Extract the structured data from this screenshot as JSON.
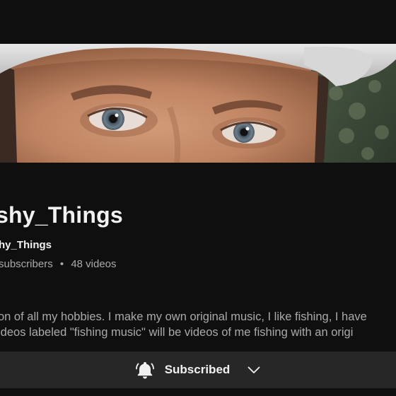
{
  "channel": {
    "name": "shy_Things",
    "handle": "hy_Things",
    "subscribers": "subscribers",
    "videos": "48 videos",
    "separator": "•"
  },
  "description": {
    "line1": "on of all my hobbies. I make my own original music, I like fishing, I have",
    "line2": "ideos labeled \"fishing music\" will be videos of me fishing with an origi"
  },
  "subscribe": {
    "label": "Subscribed"
  },
  "icons": {
    "bell": "bell-icon",
    "chevron": "chevron-down-icon"
  },
  "colors": {
    "background": "#0f0f0f",
    "bar": "#272727",
    "text_primary": "#f1f1f1",
    "text_secondary": "#aaaaaa"
  }
}
